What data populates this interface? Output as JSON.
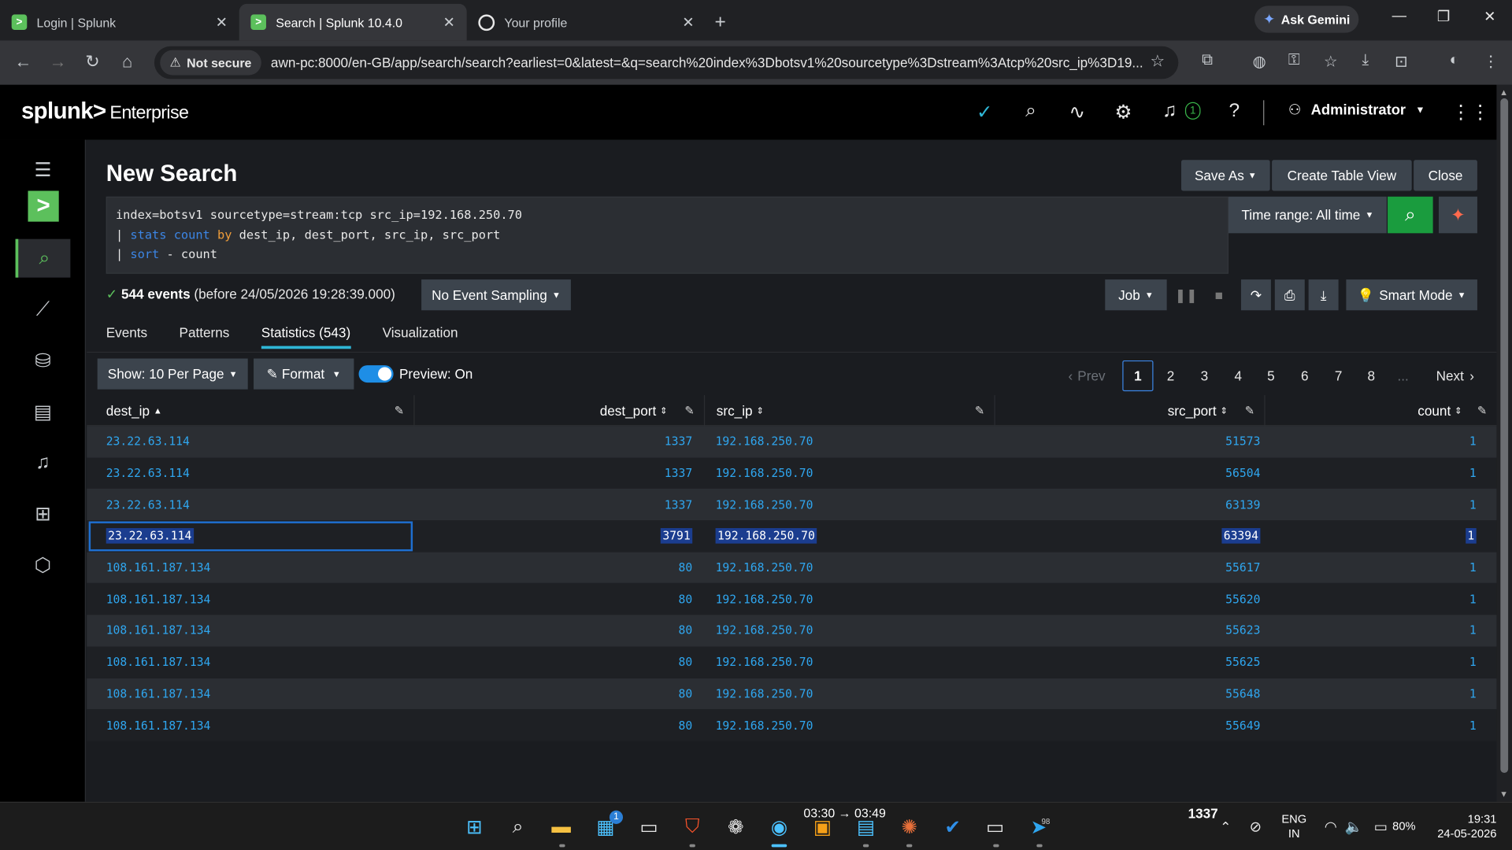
{
  "browser": {
    "tabs": [
      {
        "title": "Login | Splunk",
        "active": false
      },
      {
        "title": "Search | Splunk 10.4.0",
        "active": true
      },
      {
        "title": "Your profile",
        "active": false
      }
    ],
    "ask_gemini": "Ask Gemini",
    "not_secure": "Not secure",
    "url": "awn-pc:8000/en-GB/app/search/search?earliest=0&latest=&q=search%20index%3Dbotsv1%20sourcetype%3Dstream%3Atcp%20src_ip%3D19..."
  },
  "header": {
    "logo_brand": "splunk>",
    "logo_product": "Enterprise",
    "notification_count": "1",
    "user": "Administrator"
  },
  "page": {
    "title": "New Search",
    "save_as": "Save As",
    "create_table_view": "Create Table View",
    "close": "Close",
    "query": {
      "line1": "index=botsv1 sourcetype=stream:tcp src_ip=192.168.250.70",
      "line2_pipe": "| ",
      "line2_cmd": "stats",
      "line2_fn": " count",
      "line2_by": " by",
      "line2_rest": " dest_ip, dest_port, src_ip, src_port",
      "line3_pipe": "| ",
      "line3_cmd": "sort",
      "line3_rest": " - count"
    },
    "time_range": "Time range: All time",
    "events_count": "544 events",
    "events_before": " (before 24/05/2026 19:28:39.000)",
    "sampling": "No Event Sampling",
    "job": "Job",
    "smart_mode": "Smart Mode",
    "tabs": [
      "Events",
      "Patterns",
      "Statistics (543)",
      "Visualization"
    ],
    "show_per_page": "Show: 10 Per Page",
    "format": "Format",
    "preview": "Preview: On",
    "pager": {
      "prev": "Prev",
      "pages": [
        "1",
        "2",
        "3",
        "4",
        "5",
        "6",
        "7",
        "8"
      ],
      "ellipsis": "...",
      "next": "Next",
      "current": "1"
    }
  },
  "table": {
    "columns": [
      "dest_ip",
      "dest_port",
      "src_ip",
      "src_port",
      "count"
    ],
    "rows": [
      [
        "23.22.63.114",
        "1337",
        "192.168.250.70",
        "51573",
        "1"
      ],
      [
        "23.22.63.114",
        "1337",
        "192.168.250.70",
        "56504",
        "1"
      ],
      [
        "23.22.63.114",
        "1337",
        "192.168.250.70",
        "63139",
        "1"
      ],
      [
        "23.22.63.114",
        "3791",
        "192.168.250.70",
        "63394",
        "1"
      ],
      [
        "108.161.187.134",
        "80",
        "192.168.250.70",
        "55617",
        "1"
      ],
      [
        "108.161.187.134",
        "80",
        "192.168.250.70",
        "55620",
        "1"
      ],
      [
        "108.161.187.134",
        "80",
        "192.168.250.70",
        "55623",
        "1"
      ],
      [
        "108.161.187.134",
        "80",
        "192.168.250.70",
        "55625",
        "1"
      ],
      [
        "108.161.187.134",
        "80",
        "192.168.250.70",
        "55648",
        "1"
      ],
      [
        "108.161.187.134",
        "80",
        "192.168.250.70",
        "55649",
        "1"
      ]
    ],
    "selected_row": 3
  },
  "taskbar": {
    "media_text": "03:30 → 03:49",
    "overlay_number": "1337",
    "lang_line1": "ENG",
    "lang_line2": "IN",
    "battery": "80%",
    "time": "19:31",
    "date": "24-05-2026",
    "store_badge": "1",
    "telegram_badge": "98"
  },
  "colors": {
    "splunk_green": "#5cc05c",
    "link_blue": "#2fa6ef",
    "search_green": "#1a9c3e",
    "selection": "#1b3d8f"
  }
}
